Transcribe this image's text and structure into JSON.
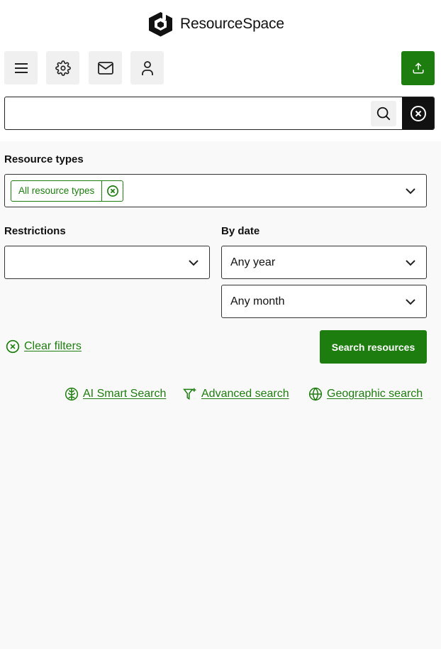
{
  "app": {
    "name": "ResourceSpace"
  },
  "toolbar": {
    "icons": [
      "menu-icon",
      "gear-icon",
      "mail-icon",
      "user-icon",
      "upload-icon"
    ]
  },
  "search": {
    "value": "",
    "placeholder": ""
  },
  "filters": {
    "resource_types_label": "Resource types",
    "resource_types_tag": "All resource types",
    "restrictions_label": "Restrictions",
    "restrictions_value": "",
    "by_date_label": "By date",
    "year_value": "Any year",
    "month_value": "Any month",
    "clear_filters": "Clear filters",
    "search_button": "Search resources"
  },
  "links": {
    "ai_smart_search": "AI Smart Search",
    "advanced_search": "Advanced search",
    "geographic_search": "Geographic search"
  },
  "colors": {
    "accent": "#1e7d0f",
    "dark": "#111111",
    "button_bg": "#f0f0f0",
    "page_bg": "#f9f9f9"
  }
}
